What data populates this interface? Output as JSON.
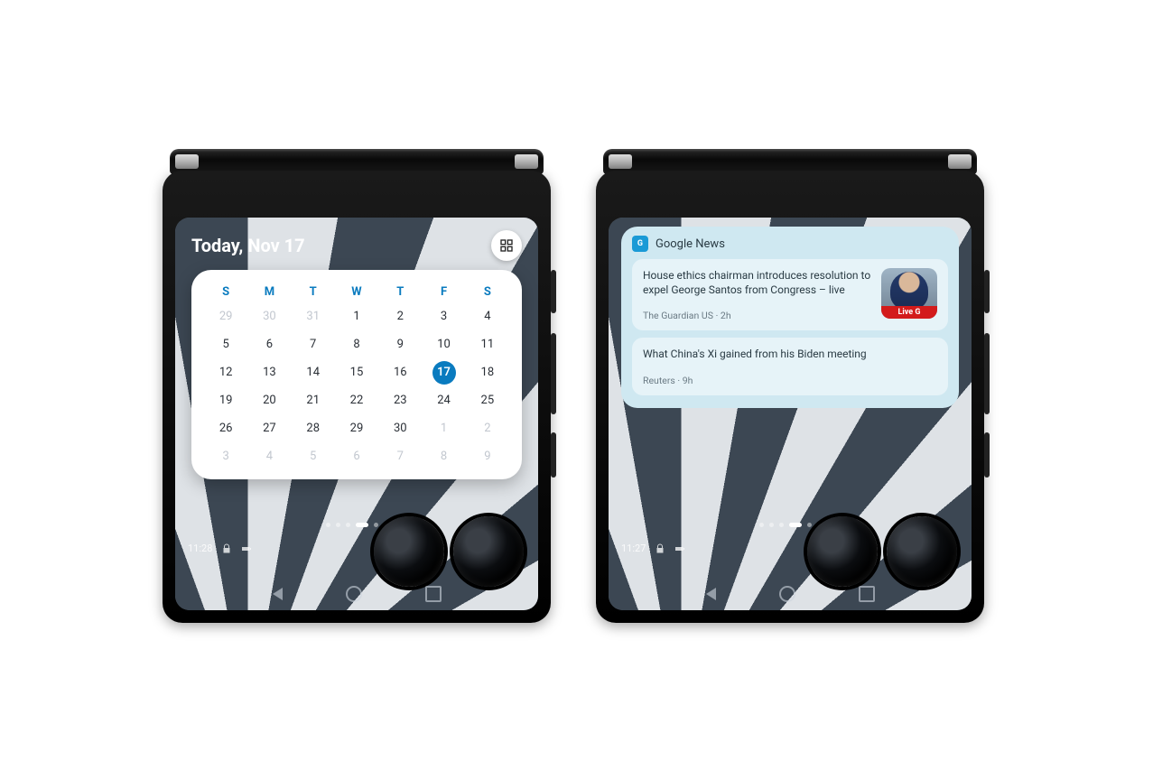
{
  "left": {
    "title": "Today, Nov 17",
    "status_time": "11:28",
    "dow": [
      "S",
      "M",
      "T",
      "W",
      "T",
      "F",
      "S"
    ],
    "weeks": [
      [
        {
          "d": "29",
          "dim": true
        },
        {
          "d": "30",
          "dim": true
        },
        {
          "d": "31",
          "dim": true
        },
        {
          "d": "1"
        },
        {
          "d": "2"
        },
        {
          "d": "3"
        },
        {
          "d": "4"
        }
      ],
      [
        {
          "d": "5"
        },
        {
          "d": "6"
        },
        {
          "d": "7"
        },
        {
          "d": "8"
        },
        {
          "d": "9"
        },
        {
          "d": "10"
        },
        {
          "d": "11"
        }
      ],
      [
        {
          "d": "12"
        },
        {
          "d": "13"
        },
        {
          "d": "14"
        },
        {
          "d": "15"
        },
        {
          "d": "16"
        },
        {
          "d": "17",
          "today": true
        },
        {
          "d": "18"
        }
      ],
      [
        {
          "d": "19"
        },
        {
          "d": "20"
        },
        {
          "d": "21"
        },
        {
          "d": "22"
        },
        {
          "d": "23"
        },
        {
          "d": "24"
        },
        {
          "d": "25"
        }
      ],
      [
        {
          "d": "26"
        },
        {
          "d": "27"
        },
        {
          "d": "28"
        },
        {
          "d": "29"
        },
        {
          "d": "30"
        },
        {
          "d": "1",
          "dim": true
        },
        {
          "d": "2",
          "dim": true
        }
      ],
      [
        {
          "d": "3",
          "dim": true
        },
        {
          "d": "4",
          "dim": true
        },
        {
          "d": "5",
          "dim": true
        },
        {
          "d": "6",
          "dim": true
        },
        {
          "d": "7",
          "dim": true
        },
        {
          "d": "8",
          "dim": true
        },
        {
          "d": "9",
          "dim": true
        }
      ]
    ]
  },
  "right": {
    "status_time": "11:27",
    "source_badge": "G",
    "source_title": "Google News",
    "thumb_tag": "Live G",
    "stories": [
      {
        "headline": "House ethics chairman introduces resolution to expel George Santos from Congress – live",
        "meta": "The Guardian US · 2h",
        "has_thumb": true
      },
      {
        "headline": "What China's Xi gained from his Biden meeting",
        "meta": "Reuters · 9h",
        "has_thumb": false
      }
    ]
  },
  "page_dots": {
    "count": 6,
    "active": 3
  }
}
